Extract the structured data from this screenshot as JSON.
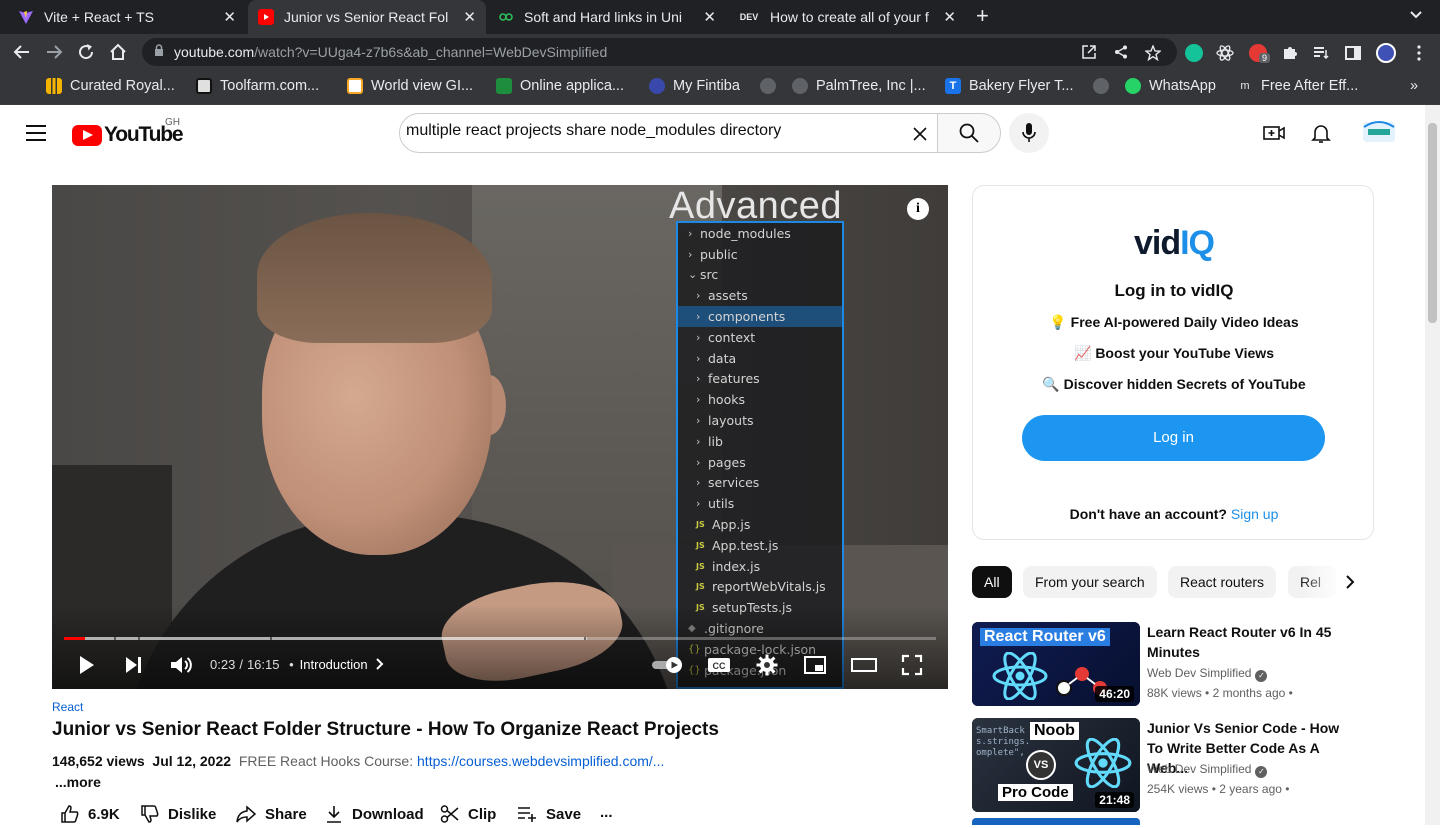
{
  "browser": {
    "tabs": [
      {
        "title": "Vite + React + TS",
        "favicon": "vite-icon"
      },
      {
        "title": "Junior vs Senior React Fol",
        "favicon": "youtube-icon"
      },
      {
        "title": "Soft and Hard links in Uni",
        "favicon": "link-icon"
      },
      {
        "title": "How to create all of your f",
        "favicon": "dev-icon",
        "favicon_text": "DEV"
      }
    ],
    "url_host": "youtube.com",
    "url_path": "/watch?v=UUga4-z7b6s&ab_channel=WebDevSimplified",
    "extension_badge": "9",
    "bookmarks": [
      "Curated Royal...",
      "Toolfarm.com...",
      "World view GI...",
      "Online applica...",
      "My Fintiba",
      "",
      "PalmTree, Inc |...",
      "Bakery Flyer T...",
      "",
      "WhatsApp",
      "Free After Eff..."
    ]
  },
  "youtube": {
    "logo_text": "YouTube",
    "country_code": "GH",
    "search_value": "multiple react projects share node_modules directory"
  },
  "player": {
    "overlay_title": "Advanced",
    "tree": [
      {
        "name": "node_modules",
        "kind": "folder",
        "depth": 0
      },
      {
        "name": "public",
        "kind": "folder",
        "depth": 0
      },
      {
        "name": "src",
        "kind": "folder-open",
        "depth": 0
      },
      {
        "name": "assets",
        "kind": "folder",
        "depth": 1
      },
      {
        "name": "components",
        "kind": "folder",
        "depth": 1,
        "selected": true
      },
      {
        "name": "context",
        "kind": "folder",
        "depth": 1
      },
      {
        "name": "data",
        "kind": "folder",
        "depth": 1
      },
      {
        "name": "features",
        "kind": "folder",
        "depth": 1
      },
      {
        "name": "hooks",
        "kind": "folder",
        "depth": 1
      },
      {
        "name": "layouts",
        "kind": "folder",
        "depth": 1
      },
      {
        "name": "lib",
        "kind": "folder",
        "depth": 1
      },
      {
        "name": "pages",
        "kind": "folder",
        "depth": 1
      },
      {
        "name": "services",
        "kind": "folder",
        "depth": 1
      },
      {
        "name": "utils",
        "kind": "folder",
        "depth": 1
      },
      {
        "name": "App.js",
        "kind": "js",
        "depth": 1
      },
      {
        "name": "App.test.js",
        "kind": "js",
        "depth": 1
      },
      {
        "name": "index.js",
        "kind": "js",
        "depth": 1
      },
      {
        "name": "reportWebVitals.js",
        "kind": "js",
        "depth": 1
      },
      {
        "name": "setupTests.js",
        "kind": "js",
        "depth": 1
      },
      {
        "name": ".gitignore",
        "kind": "dot",
        "depth": 0
      },
      {
        "name": "package-lock.json",
        "kind": "json",
        "depth": 0
      },
      {
        "name": "package.json",
        "kind": "json",
        "depth": 0
      }
    ],
    "current_time": "0:23",
    "duration": "16:15",
    "chapter": "Introduction",
    "played_fraction": 0.024,
    "loaded_fraction": 0.6
  },
  "video": {
    "tag": "React",
    "title": "Junior vs Senior React Folder Structure - How To Organize React Projects",
    "views": "148,652 views",
    "date": "Jul 12, 2022",
    "description": "FREE React Hooks Course:",
    "link": "https://courses.webdevsimplified.com/...",
    "more": "...more",
    "likes": "6.9K",
    "dislike": "Dislike",
    "share": "Share",
    "download": "Download",
    "clip": "Clip",
    "save": "Save",
    "menu": "..."
  },
  "vidiq": {
    "logo_a": "vid",
    "logo_b": "IQ",
    "heading": "Log in to vidIQ",
    "features": [
      "💡 Free AI-powered Daily Video Ideas",
      "📈 Boost your YouTube Views",
      "🔍 Discover hidden Secrets of YouTube"
    ],
    "login_label": "Log in",
    "no_account": "Don't have an account?",
    "signup": "Sign up"
  },
  "chips": [
    "All",
    "From your search",
    "React routers",
    "Rel"
  ],
  "related": [
    {
      "title": "Learn React Router v6 In 45 Minutes",
      "channel": "Web Dev Simplified",
      "views": "88K views",
      "age": "2 months ago",
      "duration": "46:20",
      "thumb_text": "React Router v6"
    },
    {
      "title": "Junior Vs Senior Code - How To Write Better Code As A Web...",
      "channel": "Web Dev Simplified",
      "views": "254K views",
      "age": "2 years ago",
      "duration": "21:48",
      "thumb_text_a": "Noob",
      "thumb_text_b": "VS",
      "thumb_text_c": "Pro Code"
    }
  ],
  "colors": {
    "youtube_red": "#ff0000",
    "link_blue": "#065fd4",
    "vidiq_blue": "#1c96f0",
    "tree_border": "#1e88e5"
  }
}
